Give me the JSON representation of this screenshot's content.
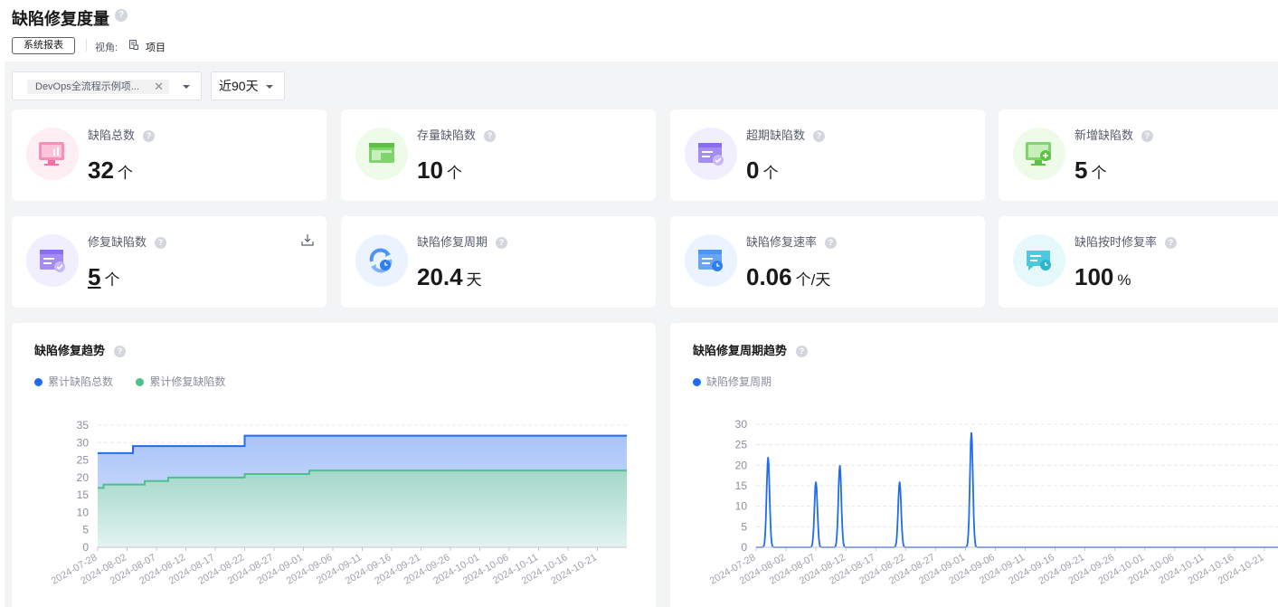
{
  "header": {
    "title": "缺陷修复度量",
    "report_button": "系统报表",
    "view_label": "视角:",
    "view_value": "项目"
  },
  "filters": {
    "project_tag": "DevOps全流程示例项...",
    "range": "近90天"
  },
  "kpis": [
    {
      "label": "缺陷总数",
      "value": "32",
      "unit": "个",
      "icon": "monitor-chart-icon"
    },
    {
      "label": "存量缺陷数",
      "value": "10",
      "unit": "个",
      "icon": "browser-window-icon"
    },
    {
      "label": "超期缺陷数",
      "value": "0",
      "unit": "个",
      "icon": "window-check-icon"
    },
    {
      "label": "新增缺陷数",
      "value": "5",
      "unit": "个",
      "icon": "monitor-plus-icon"
    },
    {
      "label": "修复缺陷数",
      "value": "5",
      "unit": "个",
      "icon": "window-check-icon"
    },
    {
      "label": "缺陷修复周期",
      "value": "20.4",
      "unit": "天",
      "icon": "refresh-clock-icon"
    },
    {
      "label": "缺陷修复速率",
      "value": "0.06",
      "unit": "个/天",
      "icon": "window-clock-icon"
    },
    {
      "label": "缺陷按时修复率",
      "value": "100",
      "unit": "%",
      "icon": "chat-clock-icon"
    }
  ],
  "colors": {
    "blue": "#1f6cf0",
    "green": "#4fbf8b",
    "purple": "#9b7bf5"
  },
  "chart_data": [
    {
      "type": "area",
      "title": "缺陷修复趋势",
      "ylim": [
        0,
        35
      ],
      "yticks": [
        0,
        5,
        10,
        15,
        20,
        25,
        30,
        35
      ],
      "xticks": [
        "2024-07-28",
        "2024-08-02",
        "2024-08-07",
        "2024-08-12",
        "2024-08-17",
        "2024-08-22",
        "2024-08-27",
        "2024-09-01",
        "2024-09-06",
        "2024-09-11",
        "2024-09-16",
        "2024-09-21",
        "2024-09-26",
        "2024-10-01",
        "2024-10-06",
        "2024-10-11",
        "2024-10-16",
        "2024-10-21"
      ],
      "series": [
        {
          "name": "累计缺陷总数",
          "color": "#1f6cf0",
          "steps": [
            [
              "2024-07-28",
              27
            ],
            [
              "2024-08-03",
              29
            ],
            [
              "2024-08-22",
              32
            ],
            [
              "2024-10-26",
              32
            ]
          ]
        },
        {
          "name": "累计修复缺陷数",
          "color": "#4fbf8b",
          "steps": [
            [
              "2024-07-28",
              17
            ],
            [
              "2024-07-29",
              18
            ],
            [
              "2024-08-05",
              19
            ],
            [
              "2024-08-09",
              20
            ],
            [
              "2024-08-22",
              21
            ],
            [
              "2024-09-02",
              22
            ],
            [
              "2024-10-26",
              22
            ]
          ]
        }
      ]
    },
    {
      "type": "line",
      "title": "缺陷修复周期趋势",
      "ylim": [
        0,
        30
      ],
      "yticks": [
        0,
        5,
        10,
        15,
        20,
        25,
        30
      ],
      "xticks": [
        "2024-07-28",
        "2024-08-02",
        "2024-08-07",
        "2024-08-12",
        "2024-08-17",
        "2024-08-22",
        "2024-08-27",
        "2024-09-01",
        "2024-09-06",
        "2024-09-11",
        "2024-09-16",
        "2024-09-21",
        "2024-09-26",
        "2024-10-01",
        "2024-10-06",
        "2024-10-11",
        "2024-10-16",
        "2024-10-21"
      ],
      "series": [
        {
          "name": "缺陷修复周期",
          "color": "#1f6cf0",
          "peaks": [
            [
              "2024-07-30",
              22
            ],
            [
              "2024-08-07",
              16
            ],
            [
              "2024-08-11",
              20
            ],
            [
              "2024-08-21",
              16
            ],
            [
              "2024-09-02",
              28
            ]
          ]
        }
      ]
    }
  ]
}
